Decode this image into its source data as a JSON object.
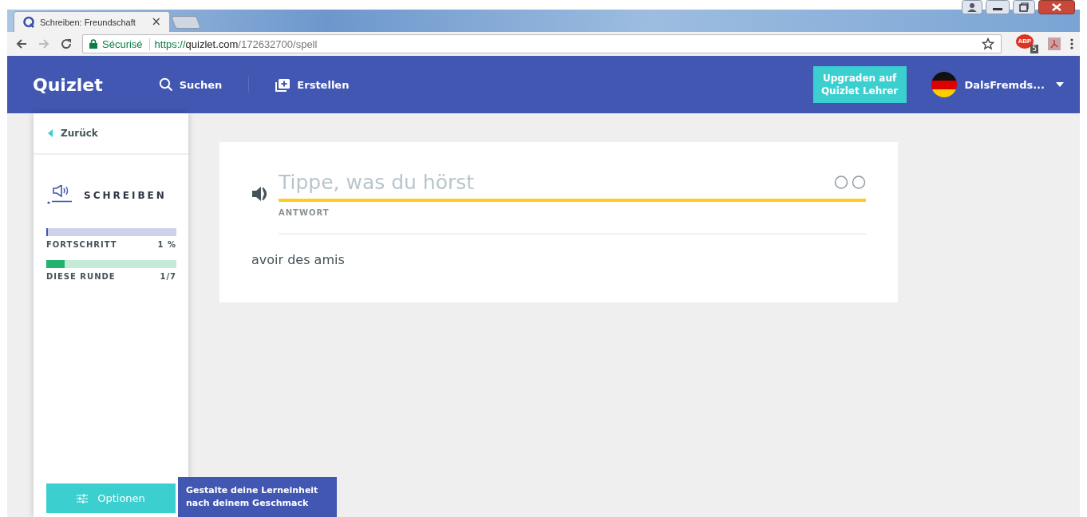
{
  "browser": {
    "tab_title": "Schreiben: Freundschaft",
    "tab_close": "×",
    "security": "Sécurisé",
    "url_scheme": "https://",
    "url_host": "quizlet.com",
    "url_path": "/172632700/spell",
    "extension_badge": "5",
    "extension_label": "ABP"
  },
  "nav": {
    "logo": "Quizlet",
    "items": [
      {
        "label": "Suchen",
        "kind": "search"
      },
      {
        "label": "Erstellen",
        "kind": "create"
      }
    ],
    "upgrade": "Upgraden auf Quizlet Lehrer",
    "user": "DalsFremds..."
  },
  "sidebar": {
    "back": "Zurück",
    "mode": "SCHREIBEN",
    "progress": [
      {
        "label": "FORTSCHRITT",
        "value": "1 %",
        "level": 0.01,
        "color": "#4257b2"
      },
      {
        "label": "DIESE RUNDE",
        "value": "1/7",
        "level": 0.14,
        "color": "#23b26d"
      }
    ],
    "options": "Optionen",
    "tooltip": "Gestalte deine Lerneinheit nach deinem Geschmack"
  },
  "card": {
    "placeholder": "Tippe, was du hörst",
    "answer_label": "ANTWORT",
    "prompt": "avoir des amis"
  }
}
